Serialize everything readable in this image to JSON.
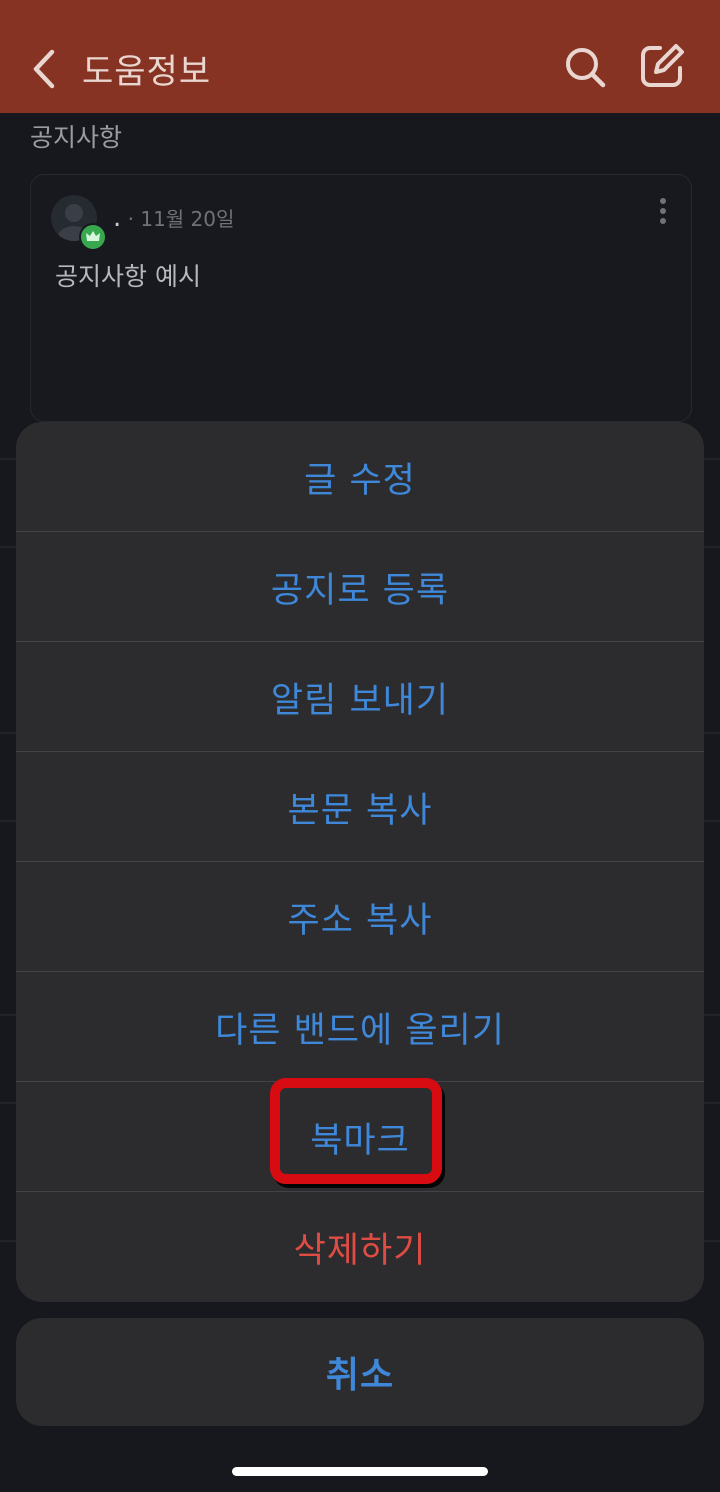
{
  "header": {
    "title": "도움정보"
  },
  "section": {
    "label": "공지사항"
  },
  "post": {
    "author": ".",
    "date": "· 11월 20일",
    "text": "공지사항 예시"
  },
  "sheet": {
    "actions": [
      {
        "label": "글 수정"
      },
      {
        "label": "공지로 등록"
      },
      {
        "label": "알림 보내기"
      },
      {
        "label": "본문 복사"
      },
      {
        "label": "주소 복사"
      },
      {
        "label": "다른 밴드에 올리기"
      },
      {
        "label": "북마크"
      },
      {
        "label": "삭제하기"
      }
    ],
    "cancel": "취소"
  },
  "colors": {
    "header_bg": "#873323",
    "action_text": "#3f88d9",
    "danger_text": "#e04c44",
    "highlight": "#d70c13"
  }
}
